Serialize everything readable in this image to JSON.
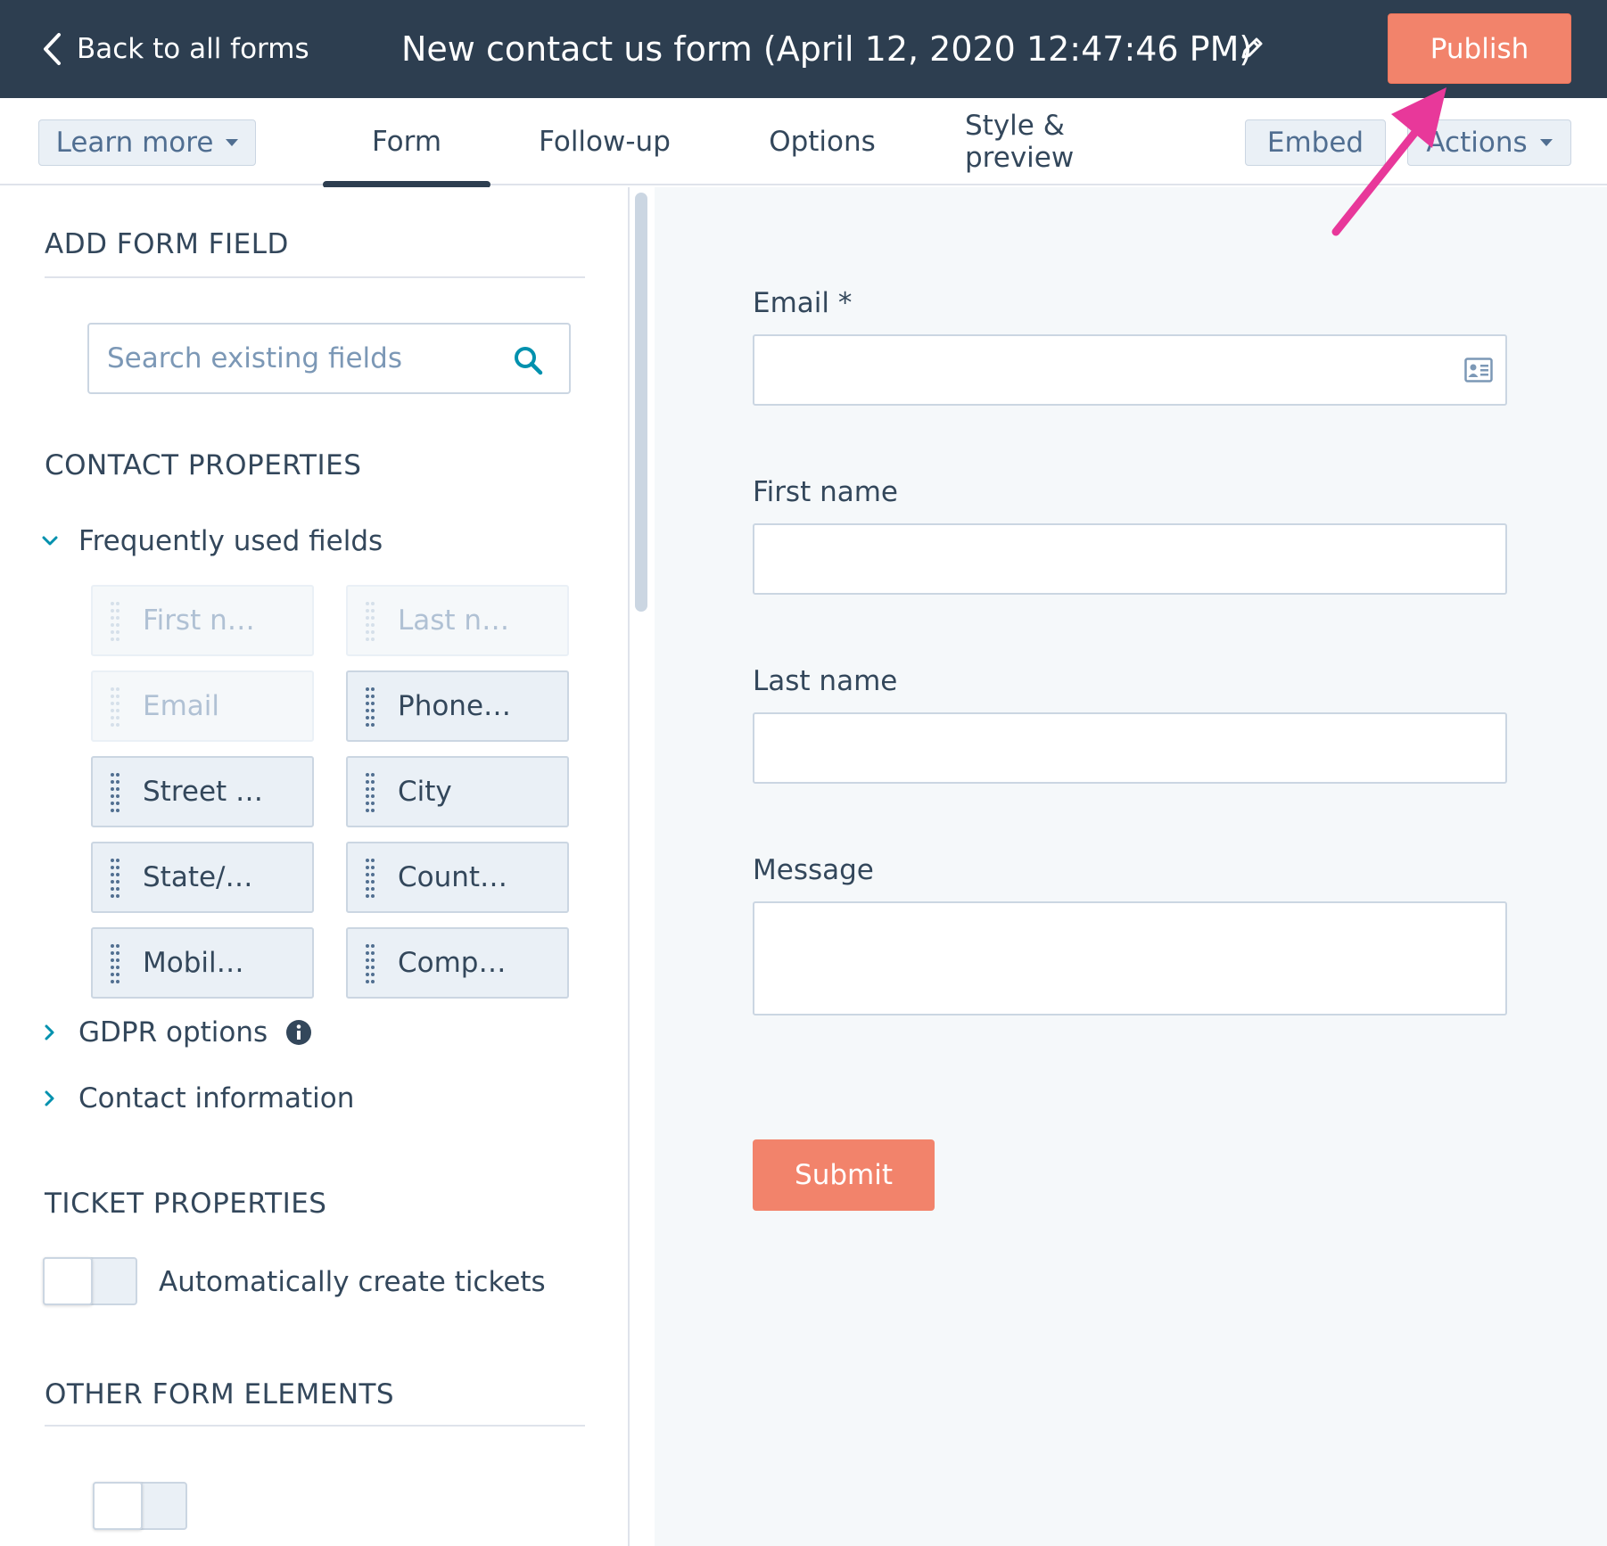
{
  "header": {
    "back_label": "Back to all forms",
    "form_title": "New contact us form (April 12, 2020 12:47:46 PM)",
    "publish_label": "Publish"
  },
  "tabbar": {
    "learn_more_label": "Learn more",
    "tabs": [
      {
        "label": "Form",
        "active": true
      },
      {
        "label": "Follow-up",
        "active": false
      },
      {
        "label": "Options",
        "active": false
      },
      {
        "label": "Style & preview",
        "active": false
      }
    ],
    "embed_label": "Embed",
    "actions_label": "Actions"
  },
  "sidebar": {
    "add_field_title": "ADD FORM FIELD",
    "search_placeholder": "Search existing fields",
    "contact_properties_title": "CONTACT PROPERTIES",
    "frequently_used_label": "Frequently used fields",
    "fields": [
      {
        "label": "First n…",
        "enabled": false
      },
      {
        "label": "Last n…",
        "enabled": false
      },
      {
        "label": "Email",
        "enabled": false
      },
      {
        "label": "Phone…",
        "enabled": true
      },
      {
        "label": "Street …",
        "enabled": true
      },
      {
        "label": "City",
        "enabled": true
      },
      {
        "label": "State/…",
        "enabled": true
      },
      {
        "label": "Count…",
        "enabled": true
      },
      {
        "label": "Mobil…",
        "enabled": true
      },
      {
        "label": "Comp…",
        "enabled": true
      }
    ],
    "gdpr_label": "GDPR options",
    "contact_info_label": "Contact information",
    "ticket_properties_title": "TICKET PROPERTIES",
    "auto_tickets_label": "Automatically create tickets",
    "other_elements_title": "OTHER FORM ELEMENTS"
  },
  "preview": {
    "email_label": "Email *",
    "first_name_label": "First name",
    "last_name_label": "Last name",
    "message_label": "Message",
    "submit_label": "Submit"
  },
  "colors": {
    "header_bg": "#2d3e50",
    "accent": "#f2836b",
    "annotation_arrow": "#e8389a"
  }
}
